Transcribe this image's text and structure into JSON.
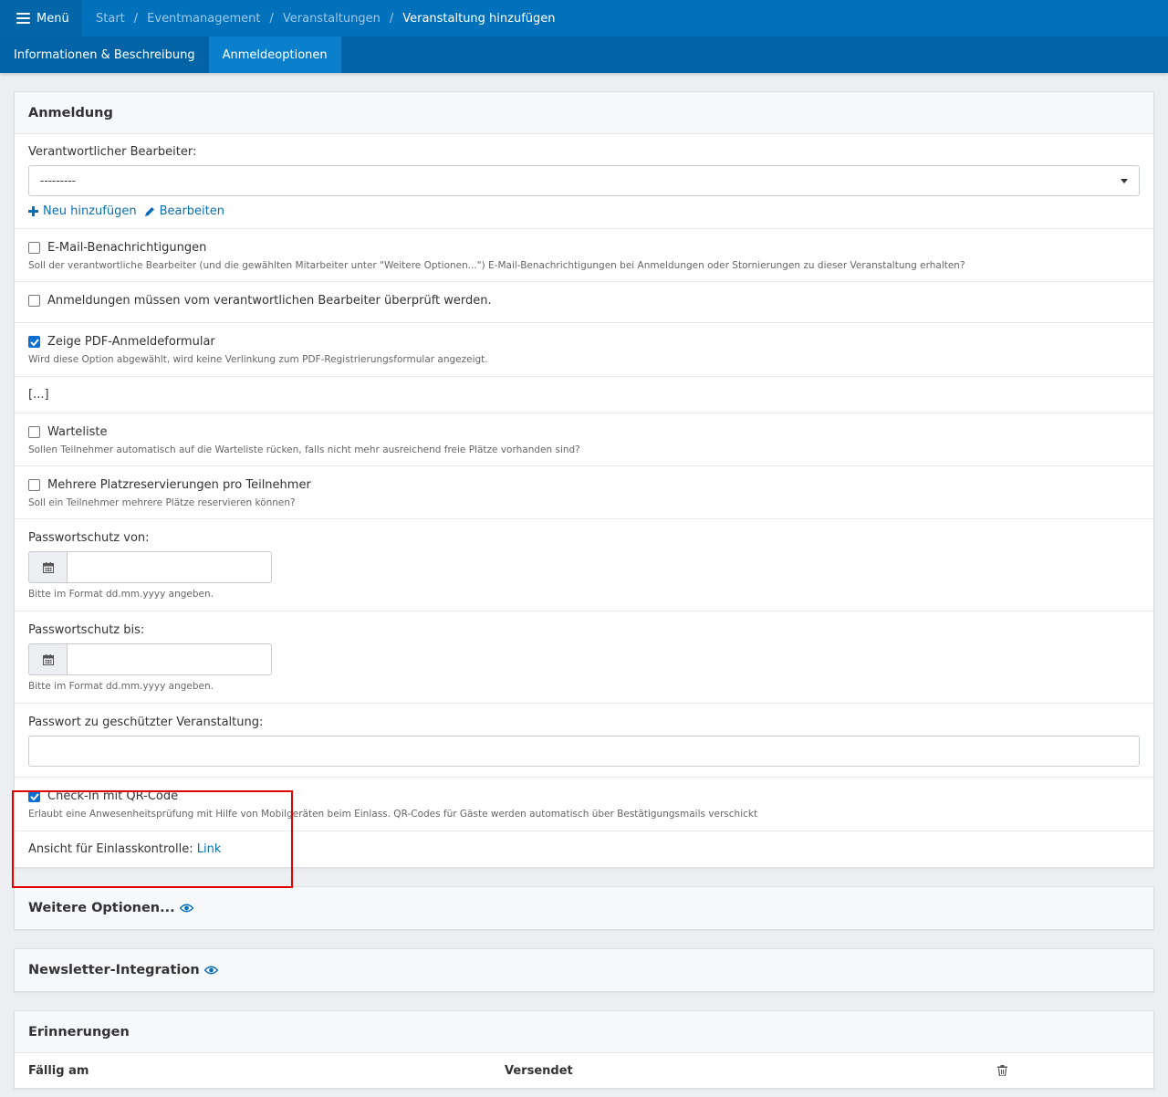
{
  "topbar": {
    "menu_label": "Menü",
    "breadcrumb": [
      "Start",
      "Eventmanagement",
      "Veranstaltungen"
    ],
    "breadcrumb_current": "Veranstaltung hinzufügen",
    "separator": "/"
  },
  "tabs": [
    {
      "label": "Informationen & Beschreibung",
      "active": false
    },
    {
      "label": "Anmeldeoptionen",
      "active": true
    }
  ],
  "anmeldung": {
    "title": "Anmeldung",
    "bearbeiter_label": "Verantwortlicher Bearbeiter:",
    "bearbeiter_value": "---------",
    "add_link": "Neu hinzufügen",
    "edit_link": "Bearbeiten",
    "email": {
      "label": "E-Mail-Benachrichtigungen",
      "checked": false,
      "help": "Soll der verantwortliche Bearbeiter (und die gewählten Mitarbeiter unter \"Weitere Optionen...\") E-Mail-Benachrichtigungen bei Anmeldungen oder Stornierungen zu dieser Veranstaltung erhalten?"
    },
    "review": {
      "label": "Anmeldungen müssen vom verantwortlichen Bearbeiter überprüft werden.",
      "checked": false
    },
    "pdf": {
      "label": "Zeige PDF-Anmeldeformular",
      "checked": true,
      "help": "Wird diese Option abgewählt, wird keine Verlinkung zum PDF-Registrierungsformular angezeigt."
    },
    "ellipsis": "[...]",
    "warteliste": {
      "label": "Warteliste",
      "checked": false,
      "help": "Sollen Teilnehmer automatisch auf die Warteliste rücken, falls nicht mehr ausreichend freie Plätze vorhanden sind?"
    },
    "mehrere": {
      "label": "Mehrere Platzreservierungen pro Teilnehmer",
      "checked": false,
      "help": "Soll ein Teilnehmer mehrere Plätze reservieren können?"
    },
    "pw_von": {
      "label": "Passwortschutz von:",
      "value": "",
      "help": "Bitte im Format dd.mm.yyyy angeben."
    },
    "pw_bis": {
      "label": "Passwortschutz bis:",
      "value": "",
      "help": "Bitte im Format dd.mm.yyyy angeben."
    },
    "pw": {
      "label": "Passwort zu geschützter Veranstaltung:",
      "value": ""
    },
    "checkin": {
      "label": "Check-In mit QR-Code",
      "checked": true,
      "help": "Erlaubt eine Anwesenheitsprüfung mit Hilfe von Mobilgeräten beim Einlass. QR-Codes für Gäste werden automatisch über Bestätigungsmails verschickt"
    },
    "einlass": {
      "label": "Ansicht für Einlasskontrolle:",
      "link": "Link"
    }
  },
  "weitere": {
    "title": "Weitere Optionen..."
  },
  "newsletter": {
    "title": "Newsletter-Integration"
  },
  "erinnerungen": {
    "title": "Erinnerungen",
    "columns": [
      "Fällig am",
      "Versendet"
    ]
  },
  "colors": {
    "topbar": "#0271bb",
    "tabbar": "#0264a6",
    "tab_active": "#0a7fcc",
    "link": "#0a6fb5",
    "highlight": "#e00000"
  }
}
